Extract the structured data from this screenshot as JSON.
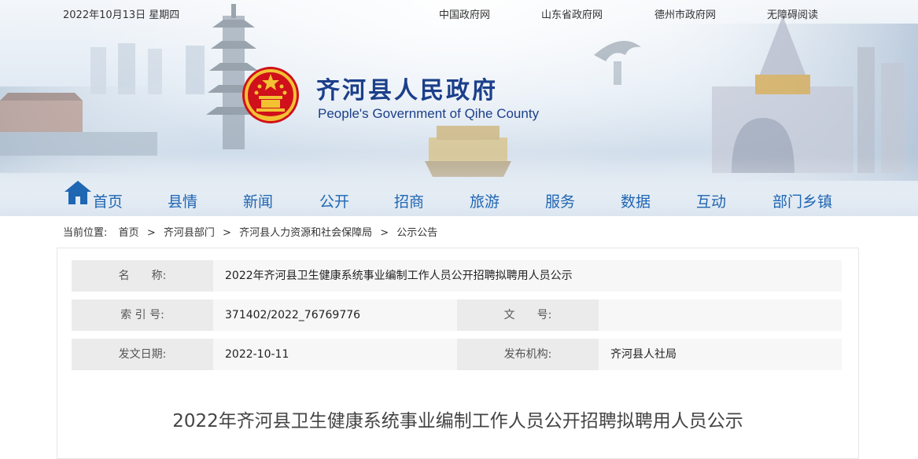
{
  "header": {
    "date": "2022年10月13日 星期四",
    "top_links": [
      "中国政府网",
      "山东省政府网",
      "德州市政府网",
      "无障碍阅读"
    ],
    "title_cn": "齐河县人民政府",
    "title_en": "People's Government of Qihe County"
  },
  "nav": {
    "items": [
      "首页",
      "县情",
      "新闻",
      "公开",
      "招商",
      "旅游",
      "服务",
      "数据",
      "互动",
      "部门乡镇"
    ]
  },
  "breadcrumb": {
    "prefix": "当前位置:",
    "items": [
      "首页",
      "齐河县部门",
      "齐河县人力资源和社会保障局",
      "公示公告"
    ],
    "separator": ">"
  },
  "info": {
    "name_label": "名　　称:",
    "name_value": "2022年齐河县卫生健康系统事业编制工作人员公开招聘拟聘用人员公示",
    "index_label": "索 引 号:",
    "index_value": "371402/2022_76769776",
    "docno_label": "文　　号:",
    "docno_value": "",
    "date_label": "发文日期:",
    "date_value": "2022-10-11",
    "org_label": "发布机构:",
    "org_value": "齐河县人社局"
  },
  "document": {
    "title": "2022年齐河县卫生健康系统事业编制工作人员公开招聘拟聘用人员公示"
  },
  "colors": {
    "nav_text": "#1f66b3",
    "title_blue": "#1b3f8a",
    "label_bg": "#ebebeb",
    "value_bg": "#f7f7f7"
  }
}
